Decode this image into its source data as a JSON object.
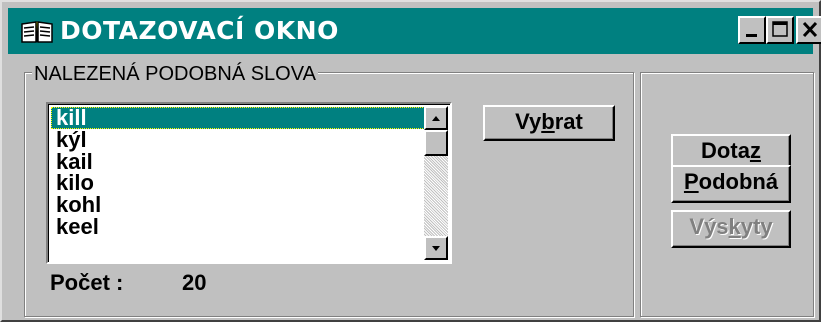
{
  "window": {
    "title": "DOTAZOVACÍ OKNO",
    "icon": "book-icon",
    "title_bg": "#008080",
    "controls": [
      "minimize-icon",
      "maximize-icon",
      "close-icon"
    ]
  },
  "results_group": {
    "label": "NALEZENÁ PODOBNÁ SLOVA",
    "items": [
      "kill",
      "kýl",
      "kail",
      "kilo",
      "kohl",
      "keel"
    ],
    "selected_item": "kill",
    "count_label": "Počet :",
    "count_value": "20",
    "select_button": {
      "prefix": "Vy",
      "mnemonic": "b",
      "suffix": "rat"
    }
  },
  "actions": {
    "query_button": {
      "prefix": "Dota",
      "mnemonic": "z",
      "suffix": ""
    },
    "similar_button": {
      "prefix": "",
      "mnemonic": "P",
      "suffix": "odobná"
    },
    "occurrences_button": {
      "prefix": "Výs",
      "mnemonic": "k",
      "suffix": "yty",
      "disabled": true
    }
  },
  "colors": {
    "selection": "#008080",
    "face": "#c0c0c0"
  }
}
